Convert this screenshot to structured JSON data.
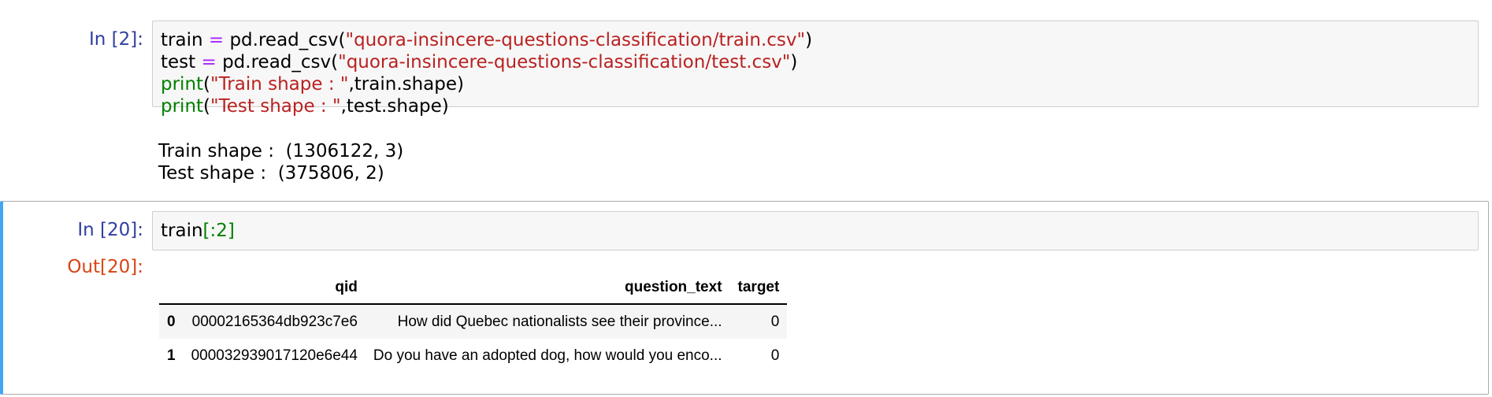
{
  "cells": [
    {
      "prompt": "In [2]:",
      "code": {
        "line1": {
          "var": "train",
          "op": "=",
          "call": "pd.read_csv(",
          "arg": "\"quora-insincere-questions-classification/train.csv\"",
          "close": ")"
        },
        "line2": {
          "var": "test",
          "op": "=",
          "call": "pd.read_csv(",
          "arg": "\"quora-insincere-questions-classification/test.csv\"",
          "close": ")"
        },
        "line3": {
          "fn": "print",
          "open": "(",
          "arg": "\"Train shape : \"",
          "rest": ",train.shape)"
        },
        "line4": {
          "fn": "print",
          "open": "(",
          "arg": "\"Test shape : \"",
          "rest": ",test.shape)"
        }
      },
      "output_lines": [
        "Train shape :  (1306122, 3)",
        "Test shape :  (375806, 2)"
      ]
    },
    {
      "prompt": "In [20]:",
      "out_prompt": "Out[20]:",
      "code": {
        "var": "train",
        "slice": "[:2]"
      },
      "table": {
        "columns": [
          "",
          "qid",
          "question_text",
          "target"
        ],
        "rows": [
          {
            "index": "0",
            "qid": "00002165364db923c7e6",
            "question_text": "How did Quebec nationalists see their province...",
            "target": "0"
          },
          {
            "index": "1",
            "qid": "000032939017120e6e44",
            "question_text": "Do you have an adopted dog, how would you enco...",
            "target": "0"
          }
        ]
      }
    }
  ],
  "colors": {
    "in_prompt": "#303f9f",
    "out_prompt": "#d84315",
    "string": "#ba2121",
    "operator": "#aa22ff",
    "builtin": "#008000",
    "selected_border": "#42a5f5"
  }
}
